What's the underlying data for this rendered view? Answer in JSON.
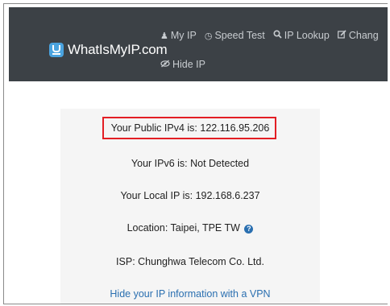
{
  "brand": {
    "name": "WhatIsMyIP.com",
    "logo_icon": "whatismyip-logo-icon",
    "logo_color": "#4aa3df"
  },
  "nav": {
    "items": [
      {
        "label": "My IP",
        "icon": "user-icon"
      },
      {
        "label": "Speed Test",
        "icon": "gauge-icon"
      },
      {
        "label": "IP Lookup",
        "icon": "search-icon"
      },
      {
        "label": "Chang",
        "icon": "edit-icon"
      }
    ],
    "hide_ip": {
      "label": "Hide IP",
      "icon": "eye-slash-icon"
    },
    "background_color": "#3c4146"
  },
  "info": {
    "ipv4_label": "Your Public IPv4 is: 122.116.95.206",
    "ipv6_label": "Your IPv6 is: Not Detected",
    "local_ip_label": "Your Local IP is: 192.168.6.237",
    "location_label": "Location: Taipei, TPE TW",
    "help_icon": "question-circle-icon",
    "isp_label": "ISP: Chunghwa Telecom Co. Ltd.",
    "vpn_link": "Hide your IP information with a VPN",
    "highlight_color": "#e31e24",
    "link_color": "#2a6fb0"
  }
}
